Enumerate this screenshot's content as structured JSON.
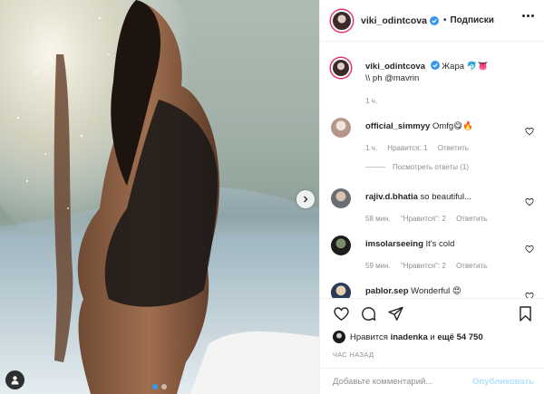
{
  "post": {
    "author": "viki_odintcova",
    "follow_label": "Подписки",
    "caption_text": "Жара 🐬👅",
    "caption_credit": "\\\\ ph @mavrin",
    "caption_time": "1 ч."
  },
  "comments": [
    {
      "user": "official_simmyy",
      "text": "Omfg😋🔥",
      "time": "1 ч.",
      "likes": "Нравится: 1",
      "reply": "Ответить"
    },
    {
      "user": "rajiv.d.bhatia",
      "text": "so beautiful...",
      "time": "58 мин.",
      "likes": "\"Нравится\": 2",
      "reply": "Ответить"
    },
    {
      "user": "imsolarseeing",
      "text": "It's cold",
      "time": "59 мин.",
      "likes": "\"Нравится\": 2",
      "reply": "Ответить"
    },
    {
      "user": "pablor.sep",
      "text": "Wonderful 😍"
    }
  ],
  "view_replies": "Посмотреть ответы (1)",
  "likes_line": {
    "prefix": "Нравится",
    "user": "inadenka",
    "middle": "и",
    "count": "ещё 54 750"
  },
  "time_ago": "час назад",
  "comment_input": {
    "placeholder": "Добавьте комментарий...",
    "publish_label": "Опубликовать"
  },
  "colors": {
    "accent": "#3897f0",
    "publish_disabled": "#b2dffc",
    "muted": "#8e8e8e",
    "story_ring": "#e1306c"
  },
  "icons": [
    "next-arrow-icon",
    "tag-user-icon",
    "verified-badge-icon",
    "more-options-icon",
    "heart-icon",
    "comment-icon",
    "share-icon",
    "bookmark-icon"
  ],
  "carousel": {
    "pages": 2,
    "current": 1
  }
}
